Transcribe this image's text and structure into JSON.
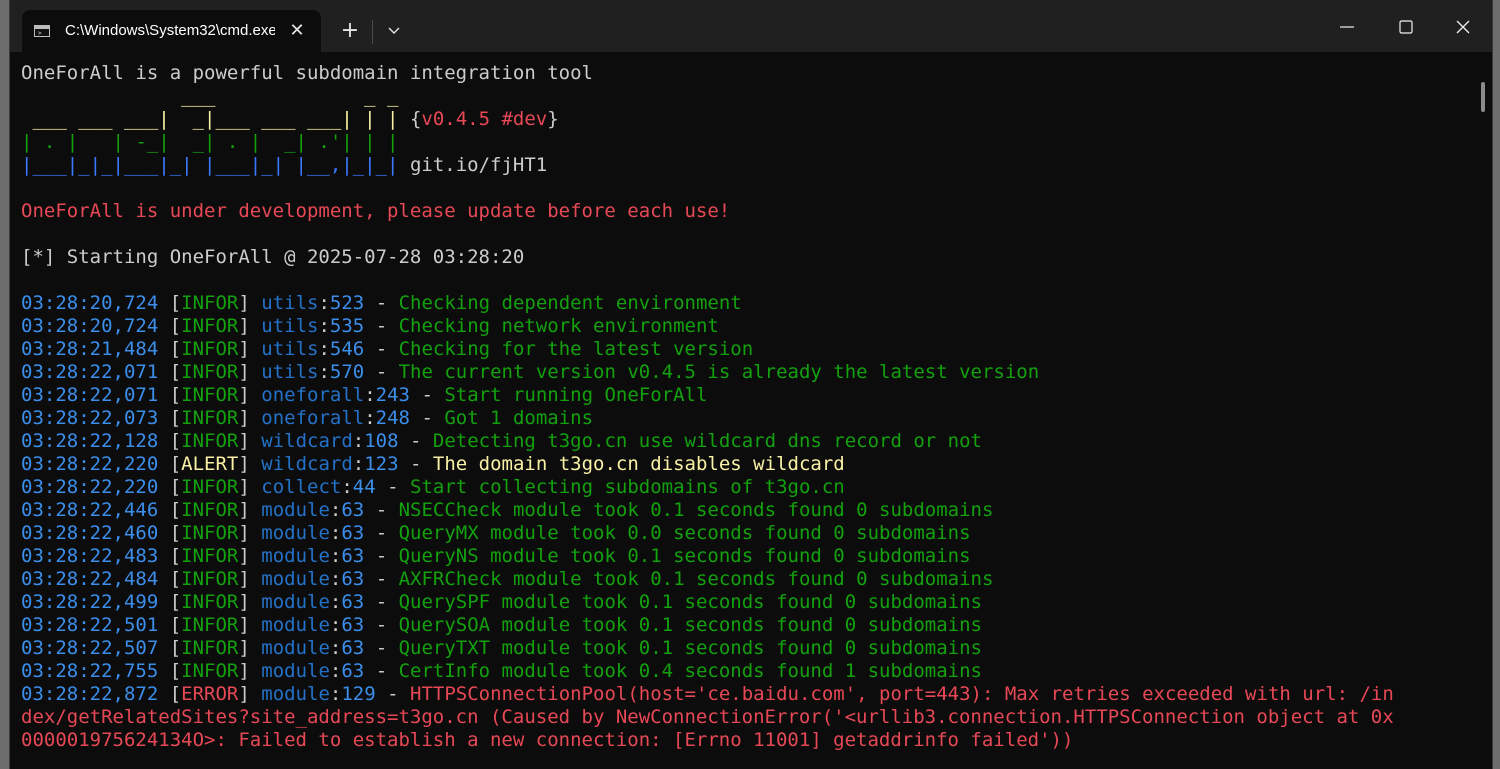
{
  "window": {
    "tab_title": "C:\\Windows\\System32\\cmd.exe",
    "tab_close": "✕",
    "new_tab": "+"
  },
  "terminal": {
    "intro": "OneForAll is a powerful subdomain integration tool",
    "banner": {
      "row1_yellow": "              ___             _ _",
      "row2_yellow": " ___ ___ ___|  _|___ ___ ___| | |",
      "row3_green": "| . |   | -_|  _| . |  _| .'| | |",
      "row4_blue": "|___|_|_|___|_| |___|_| |__,|_|_|",
      "version_open": "{",
      "version": "v0.4.5 #dev",
      "version_close": "}",
      "link": "git.io/fjHT1"
    },
    "warning": "OneForAll is under development, please update before each use!",
    "starting": "[*] Starting OneForAll @ 2025-07-28 03:28:20",
    "logs": [
      {
        "time": "03:28:20,724",
        "level": "INFOR",
        "module": "utils",
        "line": "523",
        "msg": "Checking dependent environment"
      },
      {
        "time": "03:28:20,724",
        "level": "INFOR",
        "module": "utils",
        "line": "535",
        "msg": "Checking network environment"
      },
      {
        "time": "03:28:21,484",
        "level": "INFOR",
        "module": "utils",
        "line": "546",
        "msg": "Checking for the latest version"
      },
      {
        "time": "03:28:22,071",
        "level": "INFOR",
        "module": "utils",
        "line": "570",
        "msg": "The current version v0.4.5 is already the latest version"
      },
      {
        "time": "03:28:22,071",
        "level": "INFOR",
        "module": "oneforall",
        "line": "243",
        "msg": "Start running OneForAll"
      },
      {
        "time": "03:28:22,073",
        "level": "INFOR",
        "module": "oneforall",
        "line": "248",
        "msg": "Got 1 domains"
      },
      {
        "time": "03:28:22,128",
        "level": "INFOR",
        "module": "wildcard",
        "line": "108",
        "msg": "Detecting t3go.cn use wildcard dns record or not"
      },
      {
        "time": "03:28:22,220",
        "level": "ALERT",
        "module": "wildcard",
        "line": "123",
        "msg": "The domain t3go.cn disables wildcard"
      },
      {
        "time": "03:28:22,220",
        "level": "INFOR",
        "module": "collect",
        "line": "44",
        "msg": "Start collecting subdomains of t3go.cn"
      },
      {
        "time": "03:28:22,446",
        "level": "INFOR",
        "module": "module",
        "line": "63",
        "msg": "NSECCheck module took 0.1 seconds found 0 subdomains"
      },
      {
        "time": "03:28:22,460",
        "level": "INFOR",
        "module": "module",
        "line": "63",
        "msg": "QueryMX module took 0.0 seconds found 0 subdomains"
      },
      {
        "time": "03:28:22,483",
        "level": "INFOR",
        "module": "module",
        "line": "63",
        "msg": "QueryNS module took 0.1 seconds found 0 subdomains"
      },
      {
        "time": "03:28:22,484",
        "level": "INFOR",
        "module": "module",
        "line": "63",
        "msg": "AXFRCheck module took 0.1 seconds found 0 subdomains"
      },
      {
        "time": "03:28:22,499",
        "level": "INFOR",
        "module": "module",
        "line": "63",
        "msg": "QuerySPF module took 0.1 seconds found 0 subdomains"
      },
      {
        "time": "03:28:22,501",
        "level": "INFOR",
        "module": "module",
        "line": "63",
        "msg": "QuerySOA module took 0.1 seconds found 0 subdomains"
      },
      {
        "time": "03:28:22,507",
        "level": "INFOR",
        "module": "module",
        "line": "63",
        "msg": "QueryTXT module took 0.1 seconds found 0 subdomains"
      },
      {
        "time": "03:28:22,755",
        "level": "INFOR",
        "module": "module",
        "line": "63",
        "msg": "CertInfo module took 0.4 seconds found 1 subdomains"
      }
    ],
    "error": {
      "time": "03:28:22,872",
      "level": "ERROR",
      "module": "module",
      "line": "129",
      "msg1": "HTTPSConnectionPool(host='ce.baidu.com', port=443): Max retries exceeded with url: /in",
      "msg2": "dex/getRelatedSites?site_address=t3go.cn (Caused by NewConnectionError('<urllib3.connection.HTTPSConnection object at 0x",
      "msg3": "000001975624134O>: Failed to establish a new connection: [Errno 11001] getaddrinfo failed'))"
    }
  },
  "icons": {
    "tab": "terminal-icon",
    "dropdown": "chevron-down-icon",
    "minimize": "minimize-icon",
    "maximize": "maximize-icon",
    "close": "close-icon"
  },
  "colors": {
    "background": "#0c0c0c",
    "titlebar": "#202020",
    "timestamp": "#3b8eea",
    "module": "#2472c8",
    "message": "#13a10e",
    "error": "#e74856",
    "alert": "#f9f1a5",
    "text": "#cccccc"
  }
}
